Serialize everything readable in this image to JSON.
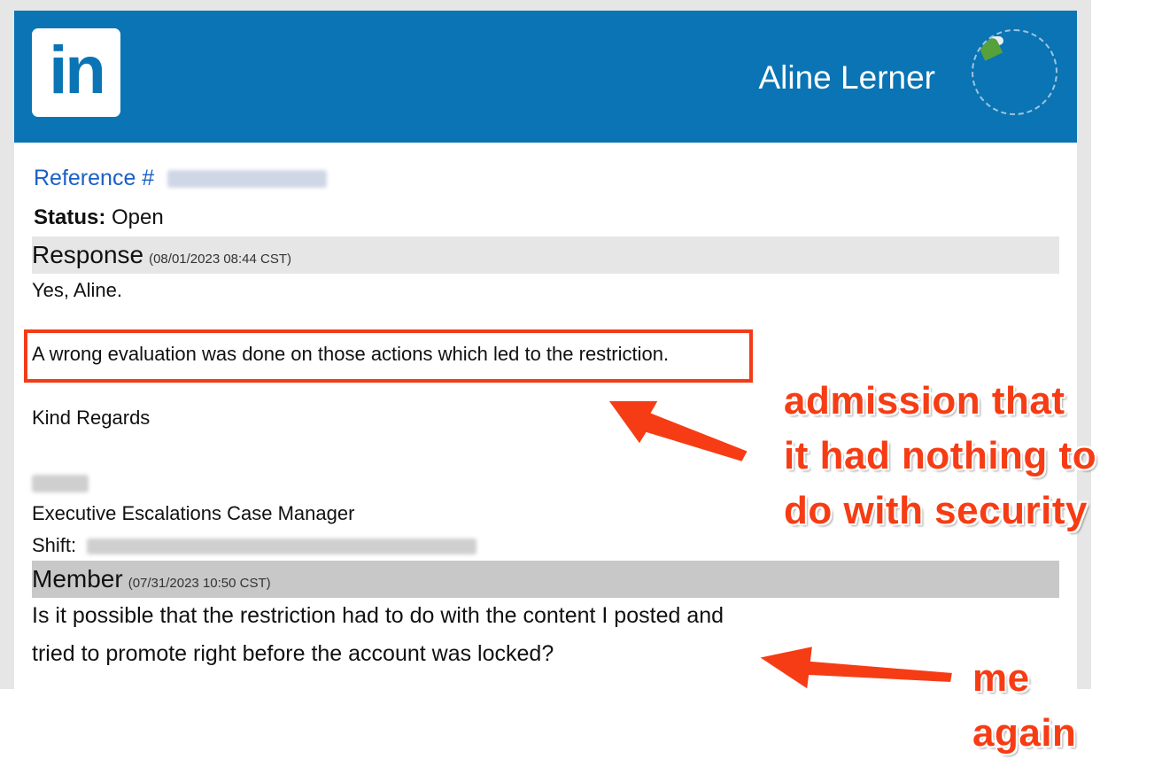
{
  "header": {
    "logo_text": "in",
    "user_name": "Aline Lerner"
  },
  "case": {
    "reference_label": "Reference #",
    "status_label": "Status:",
    "status_value": "Open"
  },
  "response": {
    "title": "Response",
    "date": "(08/01/2023 08:44 CST)",
    "greeting": "Yes, Aline.",
    "highlighted_line": "A wrong evaluation was done on those actions which led to the restriction.",
    "closing": "Kind Regards",
    "role": "Executive Escalations Case Manager",
    "shift_label": "Shift:"
  },
  "member": {
    "title": "Member",
    "date": "(07/31/2023 10:50 CST)",
    "message_line1": "Is it possible that the restriction had to do with the content I posted and",
    "message_line2": "tried to promote right before the account was locked?"
  },
  "annotations": {
    "admission": [
      "admission that",
      "it had nothing to",
      "do with security"
    ],
    "me_again": [
      "me",
      "again"
    ]
  },
  "colors": {
    "linkedin_blue": "#0a74b4",
    "annotation_red": "#f63c14",
    "link_blue": "#1b5fc6"
  }
}
